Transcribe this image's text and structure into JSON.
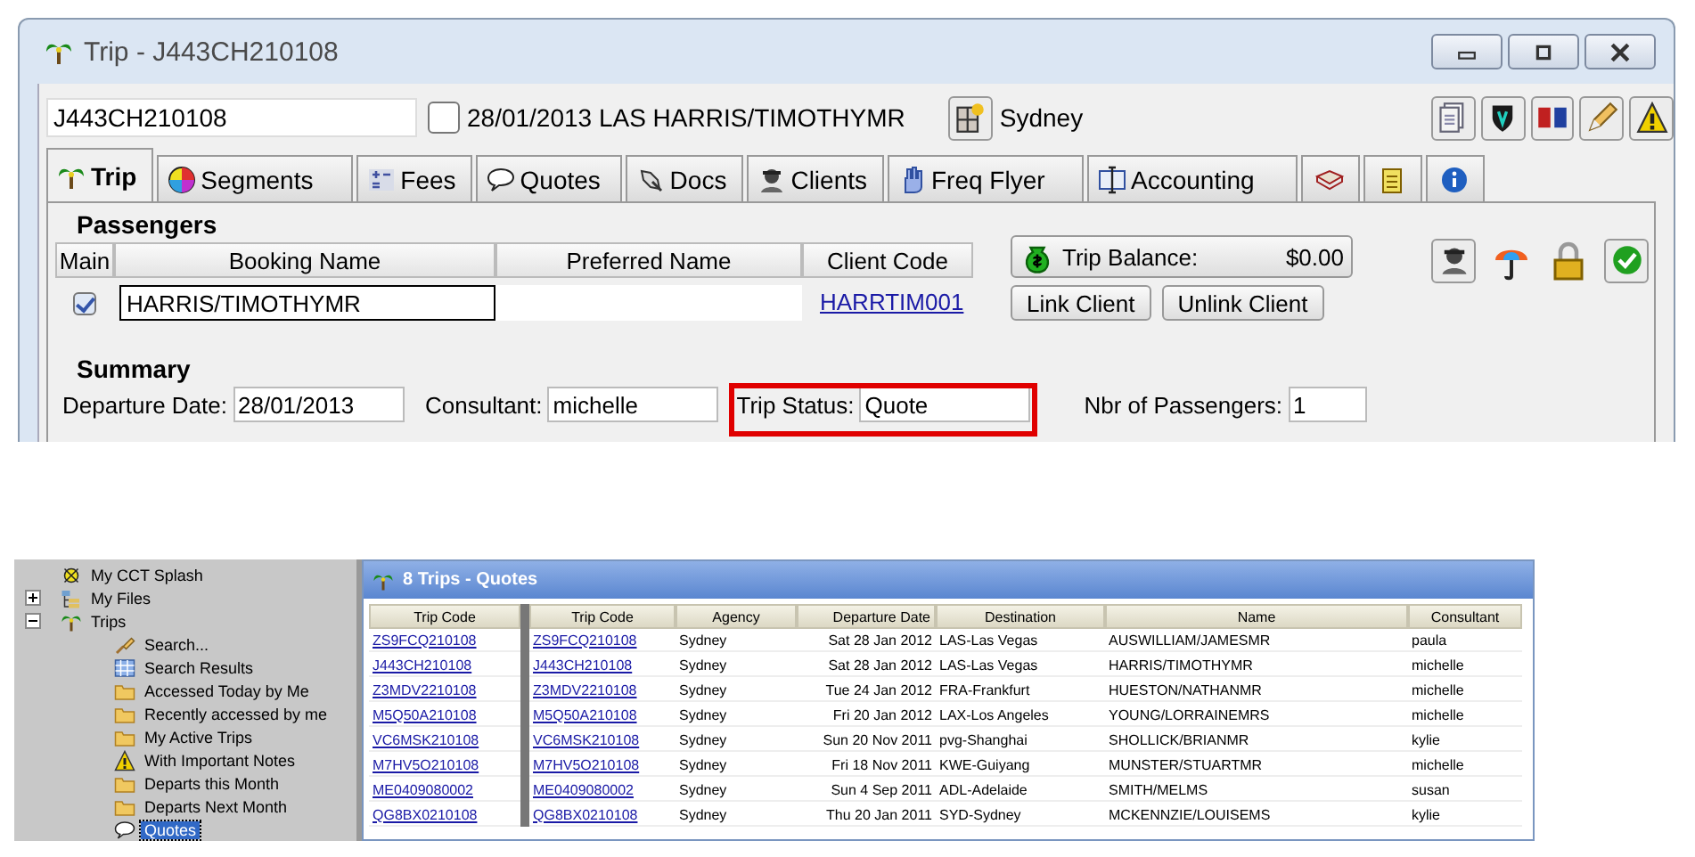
{
  "window": {
    "title": "Trip - J443CH210108"
  },
  "header": {
    "trip_code": "J443CH210108",
    "flag_checked": false,
    "summary": "28/01/2013 LAS HARRIS/TIMOTHYMR",
    "branch": "Sydney"
  },
  "tabs": [
    {
      "label": "Trip",
      "selected": true
    },
    {
      "label": "Segments",
      "selected": false
    },
    {
      "label": "Fees",
      "selected": false
    },
    {
      "label": "Quotes",
      "selected": false
    },
    {
      "label": "Docs",
      "selected": false
    },
    {
      "label": "Clients",
      "selected": false
    },
    {
      "label": "Freq Flyer",
      "selected": false
    },
    {
      "label": "Accounting",
      "selected": false
    }
  ],
  "icon_tabs": [
    {
      "selected": false
    },
    {
      "selected": false
    },
    {
      "selected": false
    }
  ],
  "passengers": {
    "title": "Passengers",
    "columns": [
      "Main",
      "Booking Name",
      "Preferred Name",
      "Client Code"
    ],
    "rows": [
      {
        "main": true,
        "booking_name": "HARRIS/TIMOTHYMR",
        "client_code": "HARRTIM001"
      }
    ]
  },
  "trip_balance": {
    "label": "Trip Balance:",
    "amount": "$0.00"
  },
  "client_buttons": [
    "Link Client",
    "Unlink Client"
  ],
  "summary": {
    "title": "Summary",
    "fields": [
      {
        "label": "Departure Date:",
        "value": "28/01/2013",
        "highlighted": false
      },
      {
        "label": "Consultant:",
        "value": "michelle",
        "highlighted": false
      },
      {
        "label": "Trip Status:",
        "value": "Quote",
        "highlighted": true
      },
      {
        "label": "Nbr of Passengers:",
        "value": "1",
        "highlighted": false
      }
    ]
  },
  "tree": [
    {
      "label": "My CCT Splash",
      "selected": false
    },
    {
      "label": "My Files",
      "selected": false,
      "expanded": false
    },
    {
      "label": "Trips",
      "selected": false,
      "expanded": true,
      "children": [
        {
          "label": "Search...",
          "selected": false
        },
        {
          "label": "Search Results",
          "selected": false
        },
        {
          "label": "Accessed Today by Me",
          "selected": false
        },
        {
          "label": "Recently accessed by me",
          "selected": false
        },
        {
          "label": "My Active Trips",
          "selected": false
        },
        {
          "label": "With Important Notes",
          "selected": false
        },
        {
          "label": "Departs this Month",
          "selected": false
        },
        {
          "label": "Departs Next Month",
          "selected": false
        },
        {
          "label": "Quotes",
          "selected": true
        }
      ]
    }
  ],
  "grid": {
    "title": "8 Trips - Quotes",
    "frozen_column": "Trip Code",
    "columns": [
      "Trip Code",
      "Agency",
      "Departure Date",
      "Destination",
      "Name",
      "Consultant"
    ],
    "rows": [
      {
        "frozen": "ZS9FCQ210108",
        "cells": [
          "ZS9FCQ210108",
          "Sydney",
          "Sat 28 Jan 2012",
          "LAS-Las Vegas",
          "AUSWILLIAM/JAMESMR",
          "paula"
        ]
      },
      {
        "frozen": "J443CH210108",
        "cells": [
          "J443CH210108",
          "Sydney",
          "Sat 28 Jan 2012",
          "LAS-Las Vegas",
          "HARRIS/TIMOTHYMR",
          "michelle"
        ]
      },
      {
        "frozen": "Z3MDV2210108",
        "cells": [
          "Z3MDV2210108",
          "Sydney",
          "Tue 24 Jan 2012",
          "FRA-Frankfurt",
          "HUESTON/NATHANMR",
          "michelle"
        ]
      },
      {
        "frozen": "M5Q50A210108",
        "cells": [
          "M5Q50A210108",
          "Sydney",
          "Fri 20 Jan 2012",
          "LAX-Los Angeles",
          "YOUNG/LORRAINEMRS",
          "michelle"
        ]
      },
      {
        "frozen": "VC6MSK210108",
        "cells": [
          "VC6MSK210108",
          "Sydney",
          "Sun 20 Nov 2011",
          "pvg-Shanghai",
          "SHOLLICK/BRIANMR",
          "kylie"
        ]
      },
      {
        "frozen": "M7HV5O210108",
        "cells": [
          "M7HV5O210108",
          "Sydney",
          "Fri 18 Nov 2011",
          "KWE-Guiyang",
          "MUNSTER/STUARTMR",
          "michelle"
        ]
      },
      {
        "frozen": "ME0409080002",
        "cells": [
          "ME0409080002",
          "Sydney",
          "Sun 4 Sep 2011",
          "ADL-Adelaide",
          "SMITH/MELMS",
          "susan"
        ]
      },
      {
        "frozen": "QG8BX0210108",
        "cells": [
          "QG8BX0210108",
          "Sydney",
          "Thu 20 Jan 2011",
          "SYD-Sydney",
          "MCKENNZIE/LOUISEMS",
          "kylie"
        ]
      }
    ]
  }
}
